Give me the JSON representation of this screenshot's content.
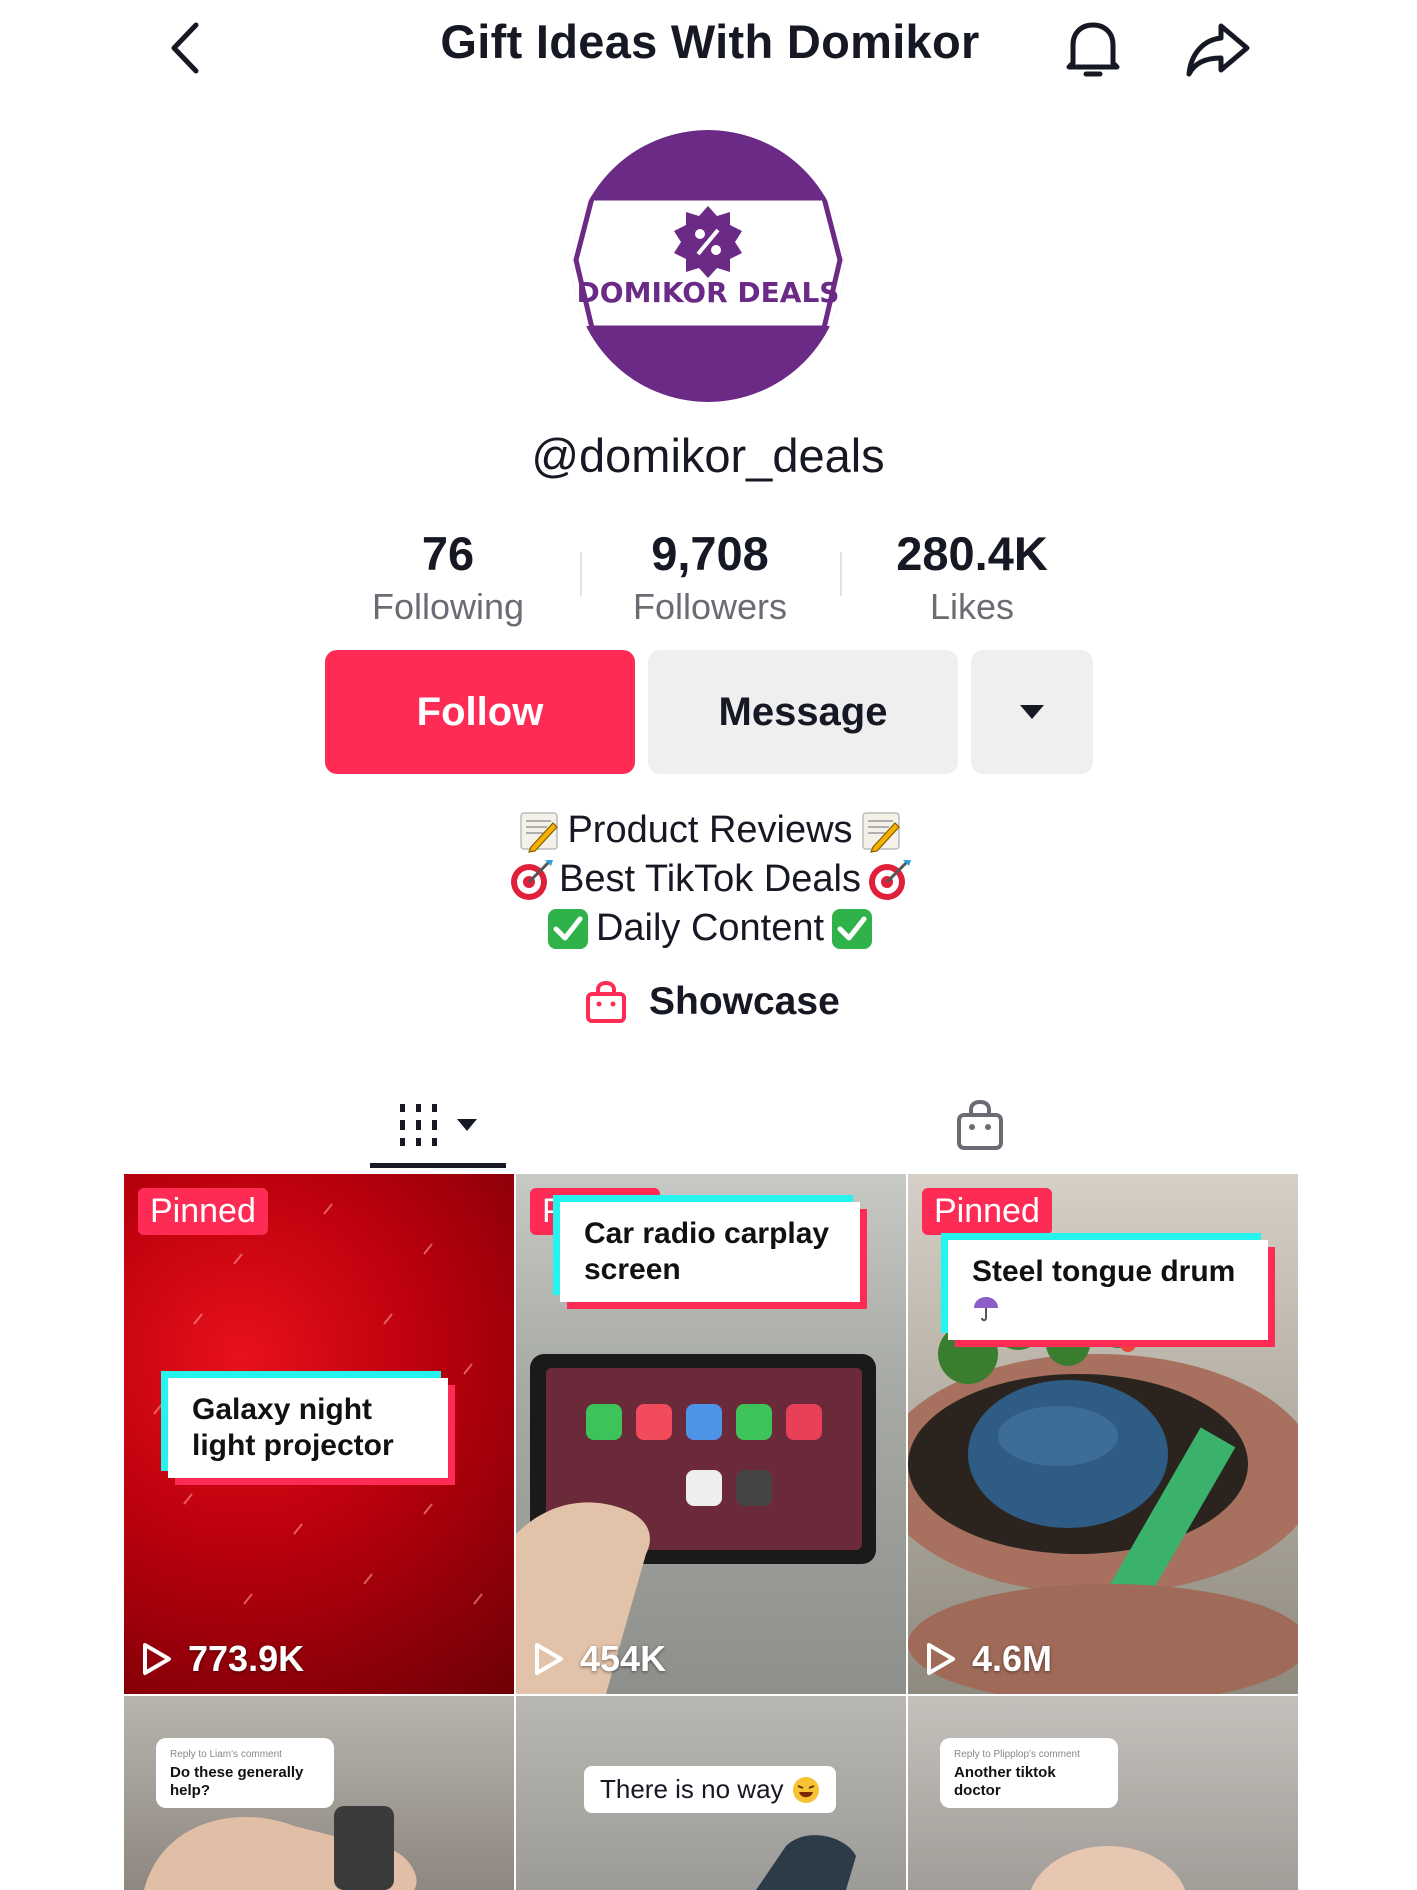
{
  "header": {
    "title": "Gift Ideas With Domikor"
  },
  "profile": {
    "avatar_text": "DOMIKOR DEALS",
    "username": "@domikor_deals",
    "stats": [
      {
        "value": "76",
        "label": "Following"
      },
      {
        "value": "9,708",
        "label": "Followers"
      },
      {
        "value": "280.4K",
        "label": "Likes"
      }
    ],
    "follow_label": "Follow",
    "message_label": "Message",
    "bio": [
      {
        "text": "Product Reviews",
        "emoji": "memo"
      },
      {
        "text": "Best TikTok Deals",
        "emoji": "direct-hit"
      },
      {
        "text": "Daily Content",
        "emoji": "check-mark"
      }
    ],
    "showcase_label": "Showcase"
  },
  "colors": {
    "accent": "#fe2c55",
    "purple": "#6b2a86",
    "check_green": "#2fb24a"
  },
  "videos": [
    {
      "pinned": "Pinned",
      "caption": "Galaxy night light projector",
      "views": "773.9K"
    },
    {
      "pinned": "Pinned",
      "caption": "Car radio carplay screen",
      "views": "454K"
    },
    {
      "pinned": "Pinned",
      "caption": "Steel tongue drum",
      "views": "4.6M"
    },
    {
      "reply_meta": "Reply to Liam's comment",
      "caption": "Do these generally help?"
    },
    {
      "caption": "There is no way"
    },
    {
      "reply_meta": "Reply to Plipplop's comment",
      "caption": "Another tiktok doctor"
    }
  ]
}
